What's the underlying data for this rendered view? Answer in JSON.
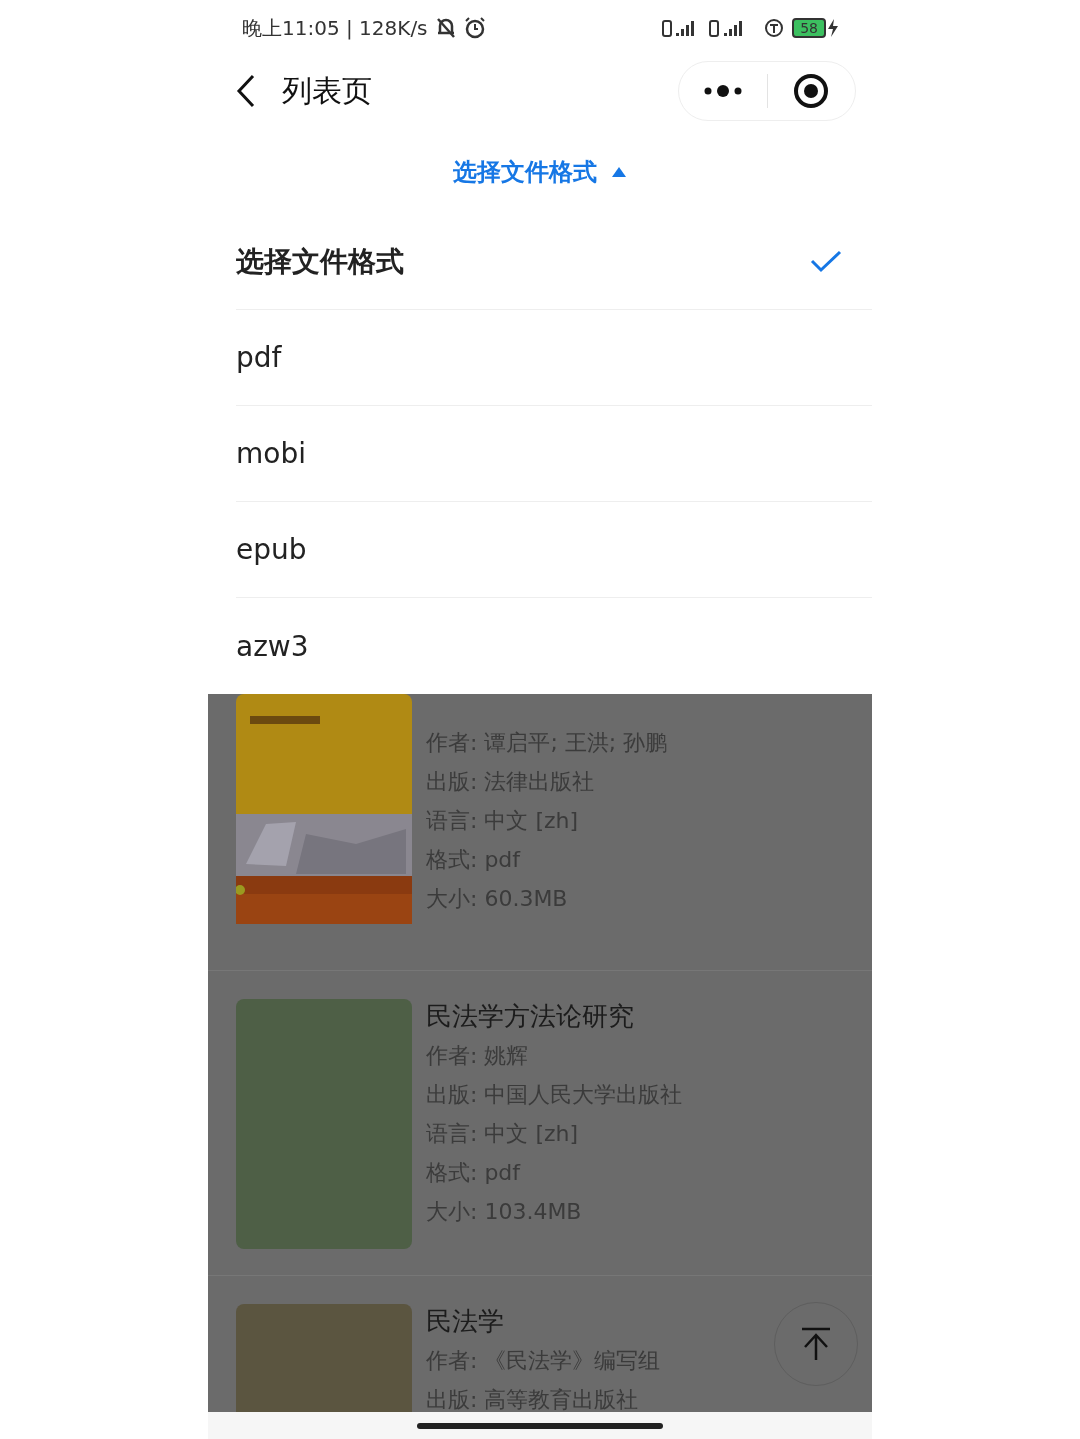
{
  "status_bar": {
    "time_speed": "晚上11:05 | 128K/s",
    "battery": "58"
  },
  "nav": {
    "title": "列表页"
  },
  "format_dropdown": {
    "label": "选择文件格式",
    "expanded": true,
    "options": [
      {
        "label": "选择文件格式",
        "selected": true
      },
      {
        "label": "pdf",
        "selected": false
      },
      {
        "label": "mobi",
        "selected": false
      },
      {
        "label": "epub",
        "selected": false
      },
      {
        "label": "azw3",
        "selected": false
      }
    ]
  },
  "books": [
    {
      "details": [
        "作者: 谭启平; 王洪; 孙鹏",
        "出版: 法律出版社",
        "语言: 中文 [zh]",
        "格式: pdf",
        "大小: 60.3MB"
      ]
    },
    {
      "cover": {
        "kind": "plain",
        "color": "#4e5f46"
      },
      "title": "民法学方法论研究",
      "details": [
        "作者: 姚辉",
        "出版: 中国人民大学出版社",
        "语言: 中文 [zh]",
        "格式: pdf",
        "大小: 103.4MB"
      ]
    },
    {
      "cover": {
        "kind": "plain",
        "color": "#5b5540"
      },
      "title": "民法学",
      "details": [
        "作者: 《民法学》编写组",
        "出版: 高等教育出版社"
      ]
    }
  ]
}
